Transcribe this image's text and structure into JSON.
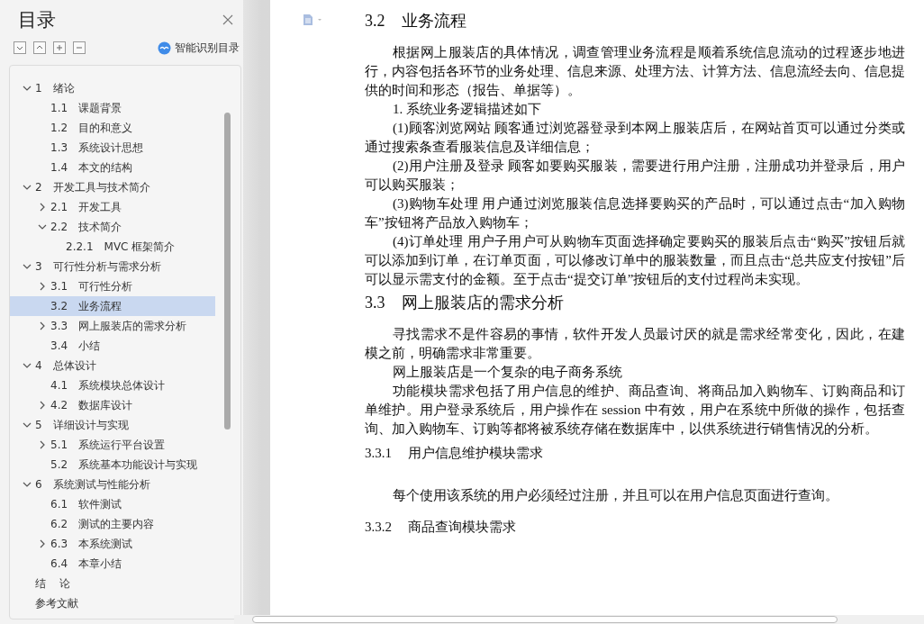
{
  "sidebar": {
    "title": "目录",
    "smart_toc_label": "智能识别目录",
    "items": [
      {
        "number": "1",
        "title": "绪论",
        "expanded": true,
        "selected": false,
        "children": [
          {
            "number": "1.1",
            "title": "课题背景",
            "selected": false
          },
          {
            "number": "1.2",
            "title": "目的和意义",
            "selected": false
          },
          {
            "number": "1.3",
            "title": "系统设计思想",
            "selected": false
          },
          {
            "number": "1.4",
            "title": "本文的结构",
            "selected": false
          }
        ]
      },
      {
        "number": "2",
        "title": "开发工具与技术简介",
        "expanded": true,
        "selected": false,
        "children": [
          {
            "number": "2.1",
            "title": "开发工具",
            "expanded": false,
            "selected": false
          },
          {
            "number": "2.2",
            "title": "技术简介",
            "expanded": true,
            "selected": false,
            "children": [
              {
                "number": "2.2.1",
                "title": "MVC 框架简介",
                "selected": false
              }
            ]
          }
        ]
      },
      {
        "number": "3",
        "title": "可行性分析与需求分析",
        "expanded": true,
        "selected": false,
        "children": [
          {
            "number": "3.1",
            "title": "可行性分析",
            "expanded": false,
            "selected": false
          },
          {
            "number": "3.2",
            "title": "业务流程",
            "selected": true
          },
          {
            "number": "3.3",
            "title": "网上服装店的需求分析",
            "expanded": false,
            "selected": false
          },
          {
            "number": "3.4",
            "title": "小结",
            "selected": false
          }
        ]
      },
      {
        "number": "4",
        "title": "总体设计",
        "expanded": true,
        "selected": false,
        "children": [
          {
            "number": "4.1",
            "title": "系统模块总体设计",
            "selected": false
          },
          {
            "number": "4.2",
            "title": "数据库设计",
            "expanded": false,
            "selected": false
          }
        ]
      },
      {
        "number": "5",
        "title": "详细设计与实现",
        "expanded": true,
        "selected": false,
        "children": [
          {
            "number": "5.1",
            "title": "系统运行平台设置",
            "expanded": false,
            "selected": false
          },
          {
            "number": "5.2",
            "title": "系统基本功能设计与实现",
            "selected": false
          }
        ]
      },
      {
        "number": "6",
        "title": "系统测试与性能分析",
        "expanded": true,
        "selected": false,
        "children": [
          {
            "number": "6.1",
            "title": "软件测试",
            "selected": false
          },
          {
            "number": "6.2",
            "title": "测试的主要内容",
            "selected": false
          },
          {
            "number": "6.3",
            "title": "本系统测试",
            "expanded": false,
            "selected": false
          },
          {
            "number": "6.4",
            "title": "本章小结",
            "selected": false
          }
        ]
      },
      {
        "title": "结    论",
        "selected": false
      },
      {
        "title": "参考文献",
        "selected": false
      }
    ]
  },
  "document": {
    "blocks": [
      {
        "kind": "h2",
        "number": "3.2",
        "text": "业务流程"
      },
      {
        "kind": "p",
        "text": "根据网上服装店的具体情况，调查管理业务流程是顺着系统信息流动的过程逐步地进行，内容包括各环节的业务处理、信息来源、处理方法、计算方法、信息流经去向、信息提供的时间和形态（报告、单据等）。"
      },
      {
        "kind": "p",
        "text": "1. 系统业务逻辑描述如下"
      },
      {
        "kind": "p",
        "text": "(1)顾客浏览网站 顾客通过浏览器登录到本网上服装店后，在网站首页可以通过分类或通过搜索条查看服装信息及详细信息；"
      },
      {
        "kind": "p",
        "text": "(2)用户注册及登录 顾客如要购买服装，需要进行用户注册，注册成功并登录后，用户可以购买服装；"
      },
      {
        "kind": "p",
        "text": "(3)购物车处理 用户通过浏览服装信息选择要购买的产品时，可以通过点击“加入购物车”按钮将产品放入购物车；"
      },
      {
        "kind": "p",
        "text": "(4)订单处理 用户子用户可从购物车页面选择确定要购买的服装后点击“购买”按钮后就可以添加到订单，在订单页面，可以修改订单中的服装数量，而且点击“总共应支付按钮”后可以显示需支付的金额。至于点击“提交订单”按钮后的支付过程尚未实现。"
      },
      {
        "kind": "h2",
        "number": "3.3",
        "text": "网上服装店的需求分析"
      },
      {
        "kind": "p",
        "text": "寻找需求不是件容易的事情，软件开发人员最讨厌的就是需求经常变化，因此，在建模之前，明确需求非常重要。"
      },
      {
        "kind": "p",
        "text": "网上服装店是一个复杂的电子商务系统"
      },
      {
        "kind": "p",
        "text": "功能模块需求包括了用户信息的维护、商品查询、将商品加入购物车、订购商品和订单维护。用户登录系统后，用户操作在 session 中有效，用户在系统中所做的操作，包括查询、加入购物车、订购等都将被系统存储在数据库中，以供系统进行销售情况的分析。"
      },
      {
        "kind": "h3",
        "number": "3.3.1",
        "text": "用户信息维护模块需求"
      },
      {
        "kind": "p",
        "text": "每个使用该系统的用户必须经过注册，并且可以在用户信息页面进行查询。"
      },
      {
        "kind": "h3",
        "number": "3.3.2",
        "text": "商品查询模块需求"
      }
    ]
  }
}
